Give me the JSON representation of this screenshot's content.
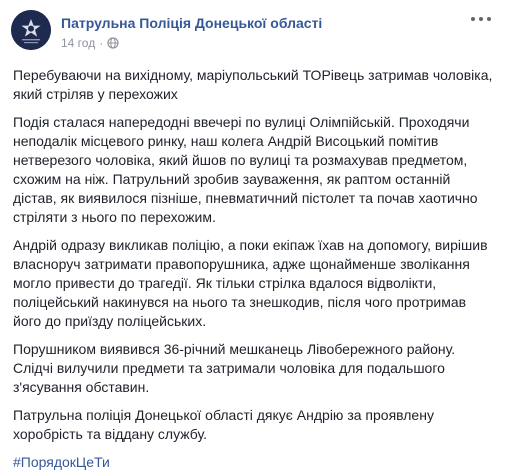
{
  "post": {
    "page_name": "Патрульна Поліція Донецької області",
    "time": "14 год",
    "separator": "·",
    "privacy_icon": "globe-icon",
    "more_icon": "more-options-icon",
    "paragraphs": [
      "Перебуваючи на вихідному, маріупольський ТОРівець затримав чоловіка, який стріляв у перехожих",
      "Подія сталася напередодні ввечері по вулиці Олімпійській. Проходячи неподалік місцевого ринку, наш колега Андрій Висоцький помітив нетверезого чоловіка, який йшов по вулиці та розмахував предметом, схожим на ніж. Патрульний зробив зауваження, як раптом останній дістав, як виявилося пізніше, пневматичний пістолет та почав хаотично стріляти з нього по перехожим.",
      "Андрій одразу викликав поліцію, а поки екіпаж їхав на допомогу, вирішив власноруч затримати правопорушника, адже щонайменше зволікання могло привести до трагедії. Як тільки стрілка вдалося відволікти, поліцейський накинувся на нього та знешкодив, після чого протримав його до приїзду поліцейських.",
      "Порушником виявився 36-річний мешканець Лівобережного району. Слідчі вилучили предмети та затримали чоловіка для подальшого з'ясування обставин.",
      "Патрульна поліція Донецької області дякує Андрію за проявлену хоробрість та віддану службу."
    ],
    "hashtag": "#ПорядокЦеТи"
  },
  "colors": {
    "link": "#365899",
    "text": "#1d2129",
    "meta": "#90949c",
    "avatar_bg": "#1e2a4e"
  }
}
